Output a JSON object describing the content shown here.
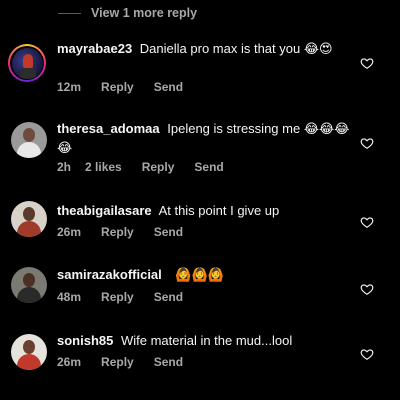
{
  "view_more": {
    "label": "View 1 more reply"
  },
  "comments": [
    {
      "username": "mayrabae23",
      "text": "Daniella pro max is that you",
      "emojis": "😂😍",
      "time": "12m",
      "likes": "",
      "reply_label": "Reply",
      "send_label": "Send"
    },
    {
      "username": "theresa_adomaa",
      "text": "Ipeleng is stressing me",
      "emojis": "😂😂😂😂",
      "time": "2h",
      "likes": "2 likes",
      "reply_label": "Reply",
      "send_label": "Send"
    },
    {
      "username": "theabigailasare",
      "text": "At this point I give up",
      "emojis": "",
      "time": "26m",
      "likes": "",
      "reply_label": "Reply",
      "send_label": "Send"
    },
    {
      "username": "samirazakofficial",
      "text": "",
      "emojis": "🙆🙆🙆",
      "time": "48m",
      "likes": "",
      "reply_label": "Reply",
      "send_label": "Send"
    },
    {
      "username": "sonish85",
      "text": "Wife material  in the mud...lool",
      "emojis": "",
      "time": "26m",
      "likes": "",
      "reply_label": "Reply",
      "send_label": "Send"
    }
  ],
  "colors": {
    "background": "#000000",
    "text": "#f5f5f5",
    "secondary": "#a8a8a8"
  },
  "icons": {
    "like": "heart-icon"
  }
}
